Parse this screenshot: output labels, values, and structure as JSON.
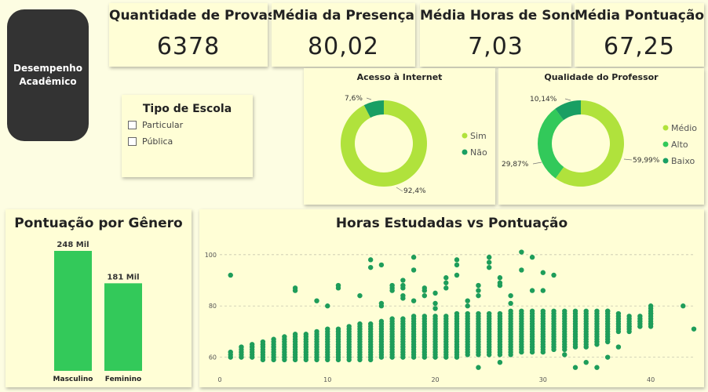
{
  "logo": {
    "text": "Desempenho Acadêmico"
  },
  "kpis": [
    {
      "title": "Quantidade de Provas",
      "value": "6378"
    },
    {
      "title": "Média da Presença",
      "value": "80,02"
    },
    {
      "title": "Média Horas de Sono",
      "value": "7,03"
    },
    {
      "title": "Média Pontuação",
      "value": "67,25"
    }
  ],
  "slicer": {
    "title": "Tipo de Escola",
    "options": [
      "Particular",
      "Pública"
    ]
  },
  "colors": {
    "light_green": "#b0e23c",
    "dark_green": "#199f63",
    "mid_green": "#32c95a",
    "bar_green": "#33c95a",
    "scatter": "#1e9d5a"
  },
  "chart_data": [
    {
      "type": "pie",
      "title": "Acesso à Internet",
      "categories": [
        "Sim",
        "Não"
      ],
      "values": [
        92.4,
        7.6
      ],
      "labels": [
        "92,4%",
        "7,6%"
      ],
      "legend": "right"
    },
    {
      "type": "pie",
      "title": "Qualidade do Professor",
      "categories": [
        "Médio",
        "Alto",
        "Baixo"
      ],
      "values": [
        59.99,
        29.87,
        10.14
      ],
      "labels": [
        "59,99%",
        "29,87%",
        "10,14%"
      ],
      "legend": "right"
    },
    {
      "type": "bar",
      "title": "Pontuação por Gênero",
      "categories": [
        "Masculino",
        "Feminino"
      ],
      "values": [
        248,
        181
      ],
      "labels": [
        "248 Mil",
        "181 Mil"
      ],
      "ylim": [
        0,
        248
      ]
    },
    {
      "type": "scatter",
      "title": "Horas Estudadas vs Pontuação",
      "xlim": [
        0,
        44
      ],
      "ylim": [
        55,
        103
      ],
      "xticks": [
        0,
        10,
        20,
        30,
        40
      ],
      "yticks": [
        60,
        80,
        100
      ],
      "grid": true,
      "columns": [
        {
          "x": 1,
          "y0": 60,
          "y1": 62
        },
        {
          "x": 2,
          "y0": 60,
          "y1": 64
        },
        {
          "x": 3,
          "y0": 60,
          "y1": 65
        },
        {
          "x": 4,
          "y0": 59,
          "y1": 66
        },
        {
          "x": 5,
          "y0": 59,
          "y1": 67
        },
        {
          "x": 6,
          "y0": 59,
          "y1": 68
        },
        {
          "x": 7,
          "y0": 59,
          "y1": 69
        },
        {
          "x": 8,
          "y0": 59,
          "y1": 69
        },
        {
          "x": 9,
          "y0": 59,
          "y1": 70
        },
        {
          "x": 10,
          "y0": 59,
          "y1": 71
        },
        {
          "x": 11,
          "y0": 59,
          "y1": 71
        },
        {
          "x": 12,
          "y0": 59,
          "y1": 72
        },
        {
          "x": 13,
          "y0": 59,
          "y1": 73
        },
        {
          "x": 14,
          "y0": 59,
          "y1": 73
        },
        {
          "x": 15,
          "y0": 60,
          "y1": 74
        },
        {
          "x": 16,
          "y0": 60,
          "y1": 75
        },
        {
          "x": 17,
          "y0": 60,
          "y1": 75
        },
        {
          "x": 18,
          "y0": 60,
          "y1": 76
        },
        {
          "x": 19,
          "y0": 60,
          "y1": 76
        },
        {
          "x": 20,
          "y0": 60,
          "y1": 76
        },
        {
          "x": 21,
          "y0": 60,
          "y1": 76
        },
        {
          "x": 22,
          "y0": 60,
          "y1": 77
        },
        {
          "x": 23,
          "y0": 61,
          "y1": 77
        },
        {
          "x": 24,
          "y0": 61,
          "y1": 77
        },
        {
          "x": 25,
          "y0": 61,
          "y1": 77
        },
        {
          "x": 26,
          "y0": 61,
          "y1": 77
        },
        {
          "x": 27,
          "y0": 61,
          "y1": 78
        },
        {
          "x": 28,
          "y0": 62,
          "y1": 78
        },
        {
          "x": 29,
          "y0": 62,
          "y1": 78
        },
        {
          "x": 30,
          "y0": 62,
          "y1": 78
        },
        {
          "x": 31,
          "y0": 63,
          "y1": 78
        },
        {
          "x": 32,
          "y0": 63,
          "y1": 78
        },
        {
          "x": 33,
          "y0": 64,
          "y1": 78
        },
        {
          "x": 34,
          "y0": 64,
          "y1": 78
        },
        {
          "x": 35,
          "y0": 65,
          "y1": 78
        },
        {
          "x": 36,
          "y0": 66,
          "y1": 78
        },
        {
          "x": 37,
          "y0": 70,
          "y1": 76
        },
        {
          "x": 38,
          "y0": 71,
          "y1": 76
        },
        {
          "x": 39,
          "y0": 72,
          "y1": 76
        },
        {
          "x": 40,
          "y0": 72,
          "y1": 79
        }
      ],
      "points": [
        [
          1,
          92
        ],
        [
          4,
          65
        ],
        [
          7,
          86
        ],
        [
          7,
          87
        ],
        [
          9,
          82
        ],
        [
          10,
          80
        ],
        [
          11,
          87
        ],
        [
          11,
          88
        ],
        [
          11,
          70
        ],
        [
          13,
          84
        ],
        [
          14,
          95
        ],
        [
          14,
          98
        ],
        [
          15,
          96
        ],
        [
          15,
          80
        ],
        [
          15,
          81
        ],
        [
          16,
          87
        ],
        [
          16,
          88
        ],
        [
          16,
          86
        ],
        [
          17,
          83
        ],
        [
          17,
          84
        ],
        [
          17,
          87
        ],
        [
          17,
          88
        ],
        [
          17,
          90
        ],
        [
          18,
          94
        ],
        [
          18,
          99
        ],
        [
          18,
          82
        ],
        [
          19,
          86
        ],
        [
          19,
          84
        ],
        [
          19,
          87
        ],
        [
          20,
          79
        ],
        [
          20,
          81
        ],
        [
          20,
          85
        ],
        [
          21,
          87
        ],
        [
          21,
          89
        ],
        [
          21,
          91
        ],
        [
          22,
          96
        ],
        [
          22,
          98
        ],
        [
          22,
          92
        ],
        [
          23,
          80
        ],
        [
          23,
          82
        ],
        [
          24,
          86
        ],
        [
          24,
          84
        ],
        [
          24,
          88
        ],
        [
          25,
          97
        ],
        [
          25,
          99
        ],
        [
          25,
          95
        ],
        [
          26,
          88
        ],
        [
          26,
          91
        ],
        [
          26,
          89
        ],
        [
          27,
          81
        ],
        [
          27,
          84
        ],
        [
          28,
          94
        ],
        [
          28,
          101
        ],
        [
          29,
          99
        ],
        [
          29,
          86
        ],
        [
          30,
          93
        ],
        [
          30,
          86
        ],
        [
          31,
          92
        ],
        [
          24,
          56
        ],
        [
          26,
          58
        ],
        [
          33,
          56
        ],
        [
          34,
          58
        ],
        [
          35,
          56
        ],
        [
          32,
          61
        ],
        [
          36,
          60
        ],
        [
          37,
          64
        ],
        [
          38,
          70
        ],
        [
          38,
          72
        ],
        [
          39,
          72
        ],
        [
          36,
          78
        ],
        [
          37,
          77
        ],
        [
          39,
          74
        ],
        [
          40,
          73
        ],
        [
          40,
          77
        ],
        [
          40,
          80
        ],
        [
          43,
          80
        ],
        [
          44,
          71
        ]
      ]
    }
  ]
}
